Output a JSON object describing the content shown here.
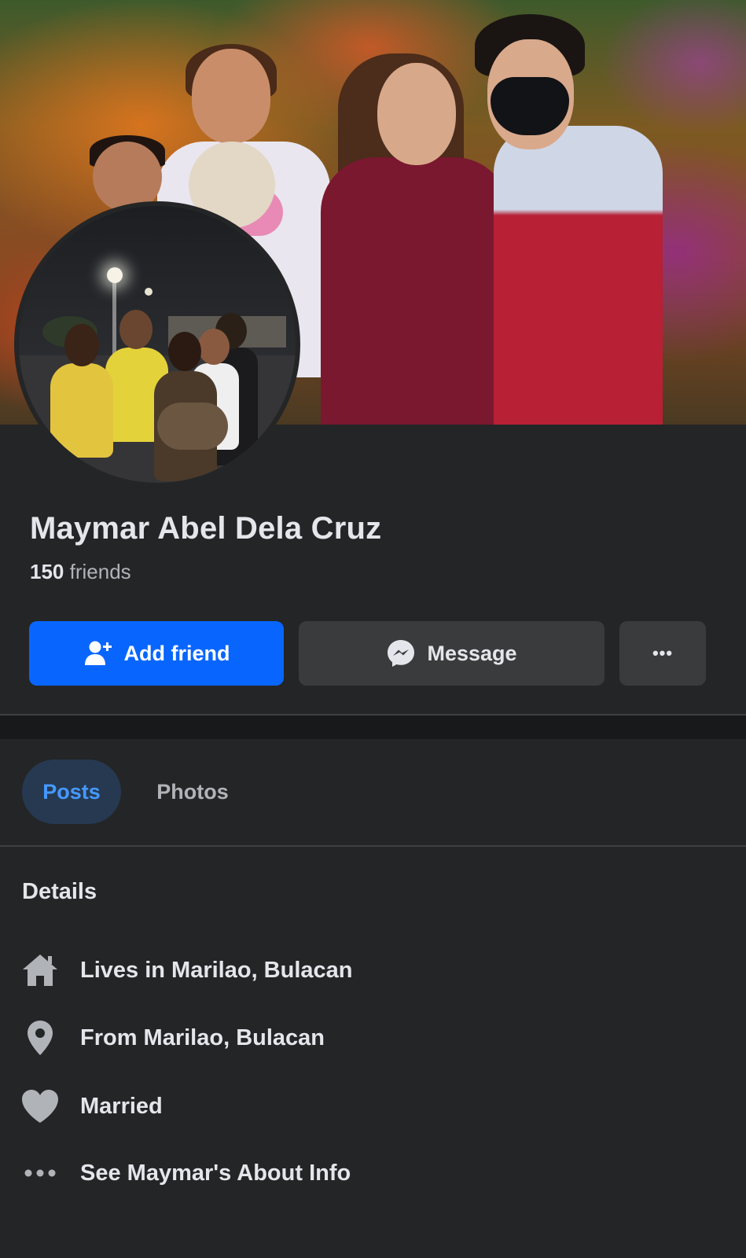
{
  "profile": {
    "name": "Maymar Abel Dela Cruz",
    "friends_count": "150",
    "friends_label": "friends"
  },
  "actions": {
    "add_friend": "Add friend",
    "message": "Message",
    "more_glyph": "•••"
  },
  "tabs": [
    {
      "label": "Posts",
      "active": true
    },
    {
      "label": "Photos",
      "active": false
    }
  ],
  "details": {
    "title": "Details",
    "items": [
      {
        "icon": "home-icon",
        "text": "Lives in Marilao, Bulacan"
      },
      {
        "icon": "location-pin-icon",
        "text": "From Marilao, Bulacan"
      },
      {
        "icon": "heart-icon",
        "text": "Married"
      },
      {
        "icon": "more-dots-icon",
        "text": "See Maymar's About Info"
      }
    ]
  },
  "colors": {
    "background": "#242526",
    "primary_button": "#0866ff",
    "secondary_button": "#3a3b3c",
    "active_tab_bg": "#263951",
    "active_tab_text": "#4599ff",
    "secondary_text": "#b0b3b8"
  }
}
